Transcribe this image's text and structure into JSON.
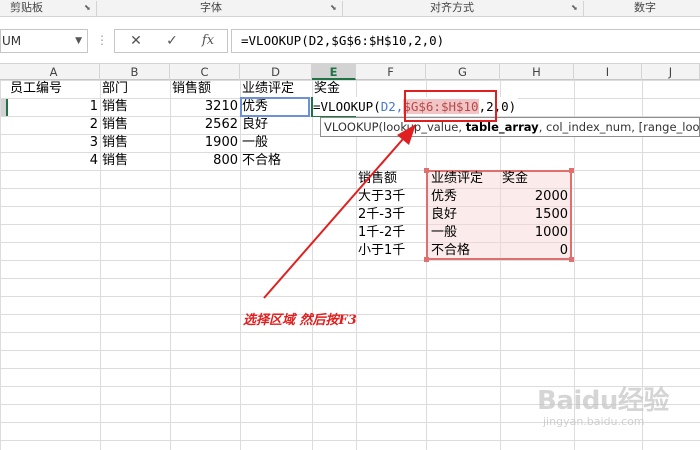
{
  "ribbon": {
    "groups": [
      {
        "label": "剪贴板"
      },
      {
        "label": "字体"
      },
      {
        "label": "对齐方式"
      },
      {
        "label": "数字"
      }
    ]
  },
  "formula_bar": {
    "name_box": "UM",
    "cancel_glyph": "✕",
    "enter_glyph": "✓",
    "fx_label": "fx",
    "formula": "=VLOOKUP(D2,$G$6:$H$10,2,0)"
  },
  "columns": [
    "A",
    "B",
    "C",
    "D",
    "E",
    "F",
    "G",
    "H",
    "I",
    "J"
  ],
  "selected_column": "E",
  "headers": {
    "a1": "员工编号",
    "b1": "部门",
    "c1": "销售额",
    "d1": "业绩评定",
    "e1": "奖金"
  },
  "rows": [
    {
      "id": "1",
      "dept": "销售",
      "sales": "3210",
      "rating": "优秀"
    },
    {
      "id": "2",
      "dept": "销售",
      "sales": "2562",
      "rating": "良好"
    },
    {
      "id": "3",
      "dept": "销售",
      "sales": "1900",
      "rating": "一般"
    },
    {
      "id": "4",
      "dept": "销售",
      "sales": "800",
      "rating": "不合格"
    }
  ],
  "editing": {
    "prefix": "=VLOOKUP(",
    "arg_ref": "D2,",
    "range_ref": "$G$6:$H$10",
    "suffix": ",2,0)"
  },
  "tooltip": {
    "fn": "VLOOKUP(",
    "arg1": "lookup_value, ",
    "arg2": "table_array",
    "rest": ", col_index_num, [range_lookup])"
  },
  "lookup_table": {
    "col_f_header": "销售额",
    "col_g_header": "业绩评定",
    "col_h_header": "奖金",
    "rows": [
      {
        "range": "大于3千",
        "rating": "优秀",
        "bonus": "2000"
      },
      {
        "range": "2千-3千",
        "rating": "良好",
        "bonus": "1500"
      },
      {
        "range": "1千-2千",
        "rating": "一般",
        "bonus": "1000"
      },
      {
        "range": "小于1千",
        "rating": "不合格",
        "bonus": "0"
      }
    ]
  },
  "annotation": "选择区域 然后按F3",
  "watermark": {
    "logo": "Baidu经验",
    "sub": "jingyan.baidu.com"
  },
  "colors": {
    "excel_green": "#217346",
    "annotation_red": "#e02020",
    "range_highlight": "#e07070",
    "ref_blue": "#4a78c8"
  }
}
